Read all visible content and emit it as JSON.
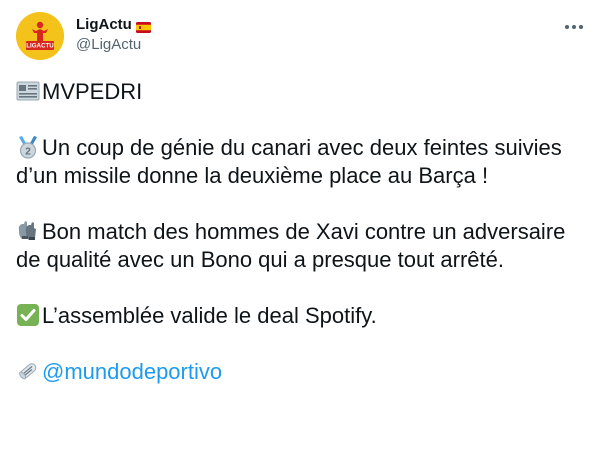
{
  "author": {
    "display_name": "LigActu",
    "handle": "@LigActu",
    "avatar_text": "LIGACTU",
    "flag_icon": "spain-flag-icon",
    "more_icon": "more-options-icon"
  },
  "tweet": {
    "line_1": "MVPEDRI",
    "line_1_icon": "newspaper-icon",
    "line_2": "Un coup de génie du canari avec deux feintes suivies d’un missile donne la deuxième place au Barça !",
    "line_2_icon": "second-place-medal-icon",
    "line_3": "Bon match des hommes de Xavi contre un adversaire de qualité avec un Bono qui a presque tout arrêté.",
    "line_3_icon": "gloves-icon",
    "line_4": "L’assemblée valide le deal Spotify.",
    "line_4_icon": "check-mark-icon",
    "mention": "@mundodeportivo",
    "mention_icon": "rolled-newspaper-icon"
  },
  "colors": {
    "accent": "#1d9bf0",
    "text": "#0f1419",
    "secondary": "#536471",
    "check_green": "#77b255",
    "avatar_yellow": "#f3c21b",
    "avatar_red": "#d6281e"
  }
}
